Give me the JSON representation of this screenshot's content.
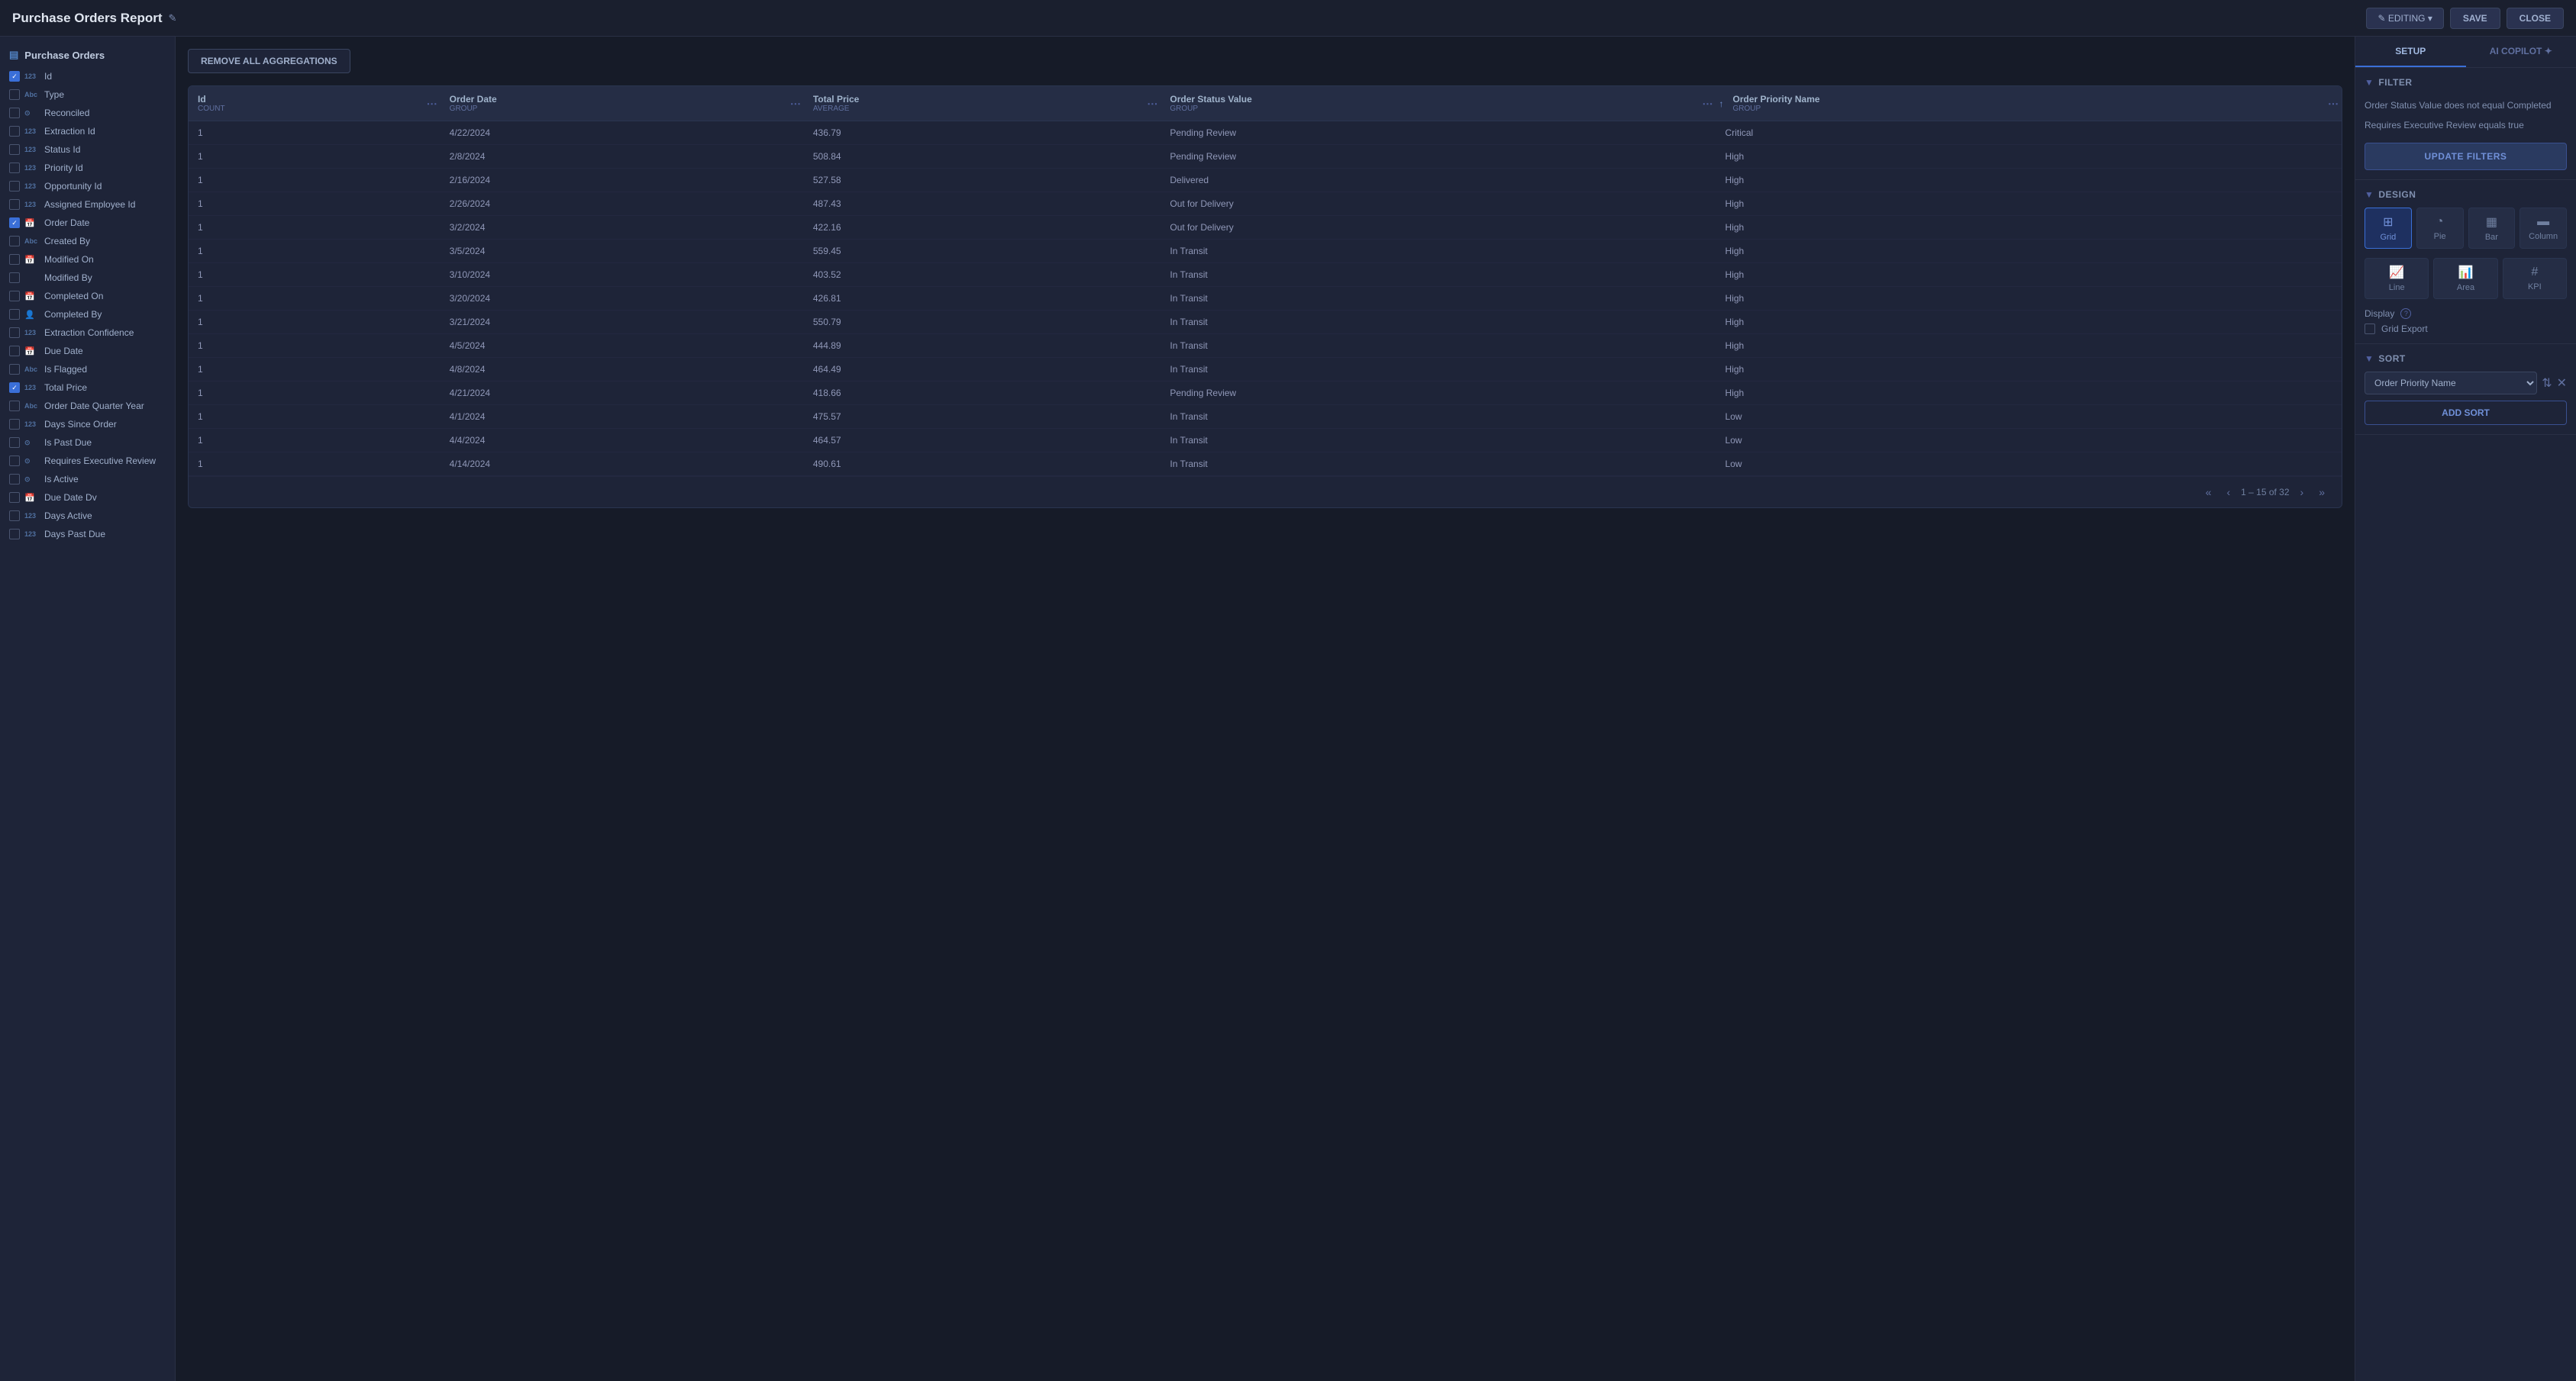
{
  "topbar": {
    "title": "Purchase Orders Report",
    "edit_icon": "✎",
    "editing_label": "✎ EDITING ▾",
    "save_label": "SAVE",
    "close_label": "CLOSE"
  },
  "sidebar": {
    "header_label": "Purchase Orders",
    "header_icon": "▤",
    "fields": [
      {
        "id": "id",
        "name": "Id",
        "type": "123",
        "icon": null,
        "checked": true
      },
      {
        "id": "type",
        "name": "Type",
        "type": "Abc",
        "icon": null,
        "checked": false
      },
      {
        "id": "reconciled",
        "name": "Reconciled",
        "type": null,
        "icon": "toggle",
        "checked": false
      },
      {
        "id": "extraction_id",
        "name": "Extraction Id",
        "type": "123",
        "icon": null,
        "checked": false
      },
      {
        "id": "status_id",
        "name": "Status Id",
        "type": "123",
        "icon": null,
        "checked": false
      },
      {
        "id": "priority_id",
        "name": "Priority Id",
        "type": "123",
        "icon": null,
        "checked": false
      },
      {
        "id": "opportunity_id",
        "name": "Opportunity Id",
        "type": "123",
        "icon": null,
        "checked": false
      },
      {
        "id": "assigned_employee_id",
        "name": "Assigned Employee Id",
        "type": "123",
        "icon": null,
        "checked": false
      },
      {
        "id": "order_date",
        "name": "Order Date",
        "type": null,
        "icon": "calendar",
        "checked": true
      },
      {
        "id": "created_by",
        "name": "Created By",
        "type": "Abc",
        "icon": null,
        "checked": false
      },
      {
        "id": "modified_on",
        "name": "Modified On",
        "type": null,
        "icon": "calendar",
        "checked": false
      },
      {
        "id": "modified_by",
        "name": "Modified By",
        "type": null,
        "icon": null,
        "checked": false
      },
      {
        "id": "completed_on",
        "name": "Completed On",
        "type": null,
        "icon": "calendar",
        "checked": false
      },
      {
        "id": "completed_by",
        "name": "Completed By",
        "type": null,
        "icon": "person",
        "checked": false
      },
      {
        "id": "extraction_confidence",
        "name": "Extraction Confidence",
        "type": "123",
        "icon": null,
        "checked": false
      },
      {
        "id": "due_date",
        "name": "Due Date",
        "type": null,
        "icon": "calendar",
        "checked": false
      },
      {
        "id": "is_flagged",
        "name": "Is Flagged",
        "type": "Abc",
        "icon": null,
        "checked": false
      },
      {
        "id": "total_price",
        "name": "Total Price",
        "type": "123",
        "icon": null,
        "checked": true
      },
      {
        "id": "order_date_quarter_year",
        "name": "Order Date Quarter Year",
        "type": "Abc",
        "icon": null,
        "checked": false
      },
      {
        "id": "days_since_order",
        "name": "Days Since Order",
        "type": "123",
        "icon": null,
        "checked": false
      },
      {
        "id": "is_past_due",
        "name": "Is Past Due",
        "type": null,
        "icon": "toggle",
        "checked": false
      },
      {
        "id": "requires_exec_review",
        "name": "Requires Executive Review",
        "type": null,
        "icon": "toggle",
        "checked": false
      },
      {
        "id": "is_active",
        "name": "Is Active",
        "type": null,
        "icon": "toggle",
        "checked": false
      },
      {
        "id": "due_date_dv",
        "name": "Due Date Dv",
        "type": null,
        "icon": "calendar",
        "checked": false
      },
      {
        "id": "days_active",
        "name": "Days Active",
        "type": "123",
        "icon": null,
        "checked": false
      },
      {
        "id": "days_past_due",
        "name": "Days Past Due",
        "type": "123",
        "icon": null,
        "checked": false
      }
    ]
  },
  "toolbar": {
    "remove_agg_label": "REMOVE ALL AGGREGATIONS"
  },
  "table": {
    "columns": [
      {
        "name": "Id",
        "agg": "COUNT"
      },
      {
        "name": "Order Date",
        "agg": "GROUP"
      },
      {
        "name": "Total Price",
        "agg": "AVERAGE"
      },
      {
        "name": "Order Status Value",
        "agg": "GROUP"
      },
      {
        "name": "Order Priority Name",
        "agg": "GROUP"
      }
    ],
    "rows": [
      [
        "1",
        "4/22/2024",
        "436.79",
        "Pending Review",
        "Critical"
      ],
      [
        "1",
        "2/8/2024",
        "508.84",
        "Pending Review",
        "High"
      ],
      [
        "1",
        "2/16/2024",
        "527.58",
        "Delivered",
        "High"
      ],
      [
        "1",
        "2/26/2024",
        "487.43",
        "Out for Delivery",
        "High"
      ],
      [
        "1",
        "3/2/2024",
        "422.16",
        "Out for Delivery",
        "High"
      ],
      [
        "1",
        "3/5/2024",
        "559.45",
        "In Transit",
        "High"
      ],
      [
        "1",
        "3/10/2024",
        "403.52",
        "In Transit",
        "High"
      ],
      [
        "1",
        "3/20/2024",
        "426.81",
        "In Transit",
        "High"
      ],
      [
        "1",
        "3/21/2024",
        "550.79",
        "In Transit",
        "High"
      ],
      [
        "1",
        "4/5/2024",
        "444.89",
        "In Transit",
        "High"
      ],
      [
        "1",
        "4/8/2024",
        "464.49",
        "In Transit",
        "High"
      ],
      [
        "1",
        "4/21/2024",
        "418.66",
        "Pending Review",
        "High"
      ],
      [
        "1",
        "4/1/2024",
        "475.57",
        "In Transit",
        "Low"
      ],
      [
        "1",
        "4/4/2024",
        "464.57",
        "In Transit",
        "Low"
      ],
      [
        "1",
        "4/14/2024",
        "490.61",
        "In Transit",
        "Low"
      ]
    ],
    "pagination": {
      "current_range": "1 – 15",
      "total": "32",
      "display": "1 – 15 of 32"
    }
  },
  "right_panel": {
    "tabs": [
      {
        "id": "setup",
        "label": "SETUP"
      },
      {
        "id": "ai_copilot",
        "label": "AI COPILOT ✦"
      }
    ],
    "active_tab": "setup",
    "filter": {
      "section_label": "FILTER",
      "conditions": [
        "Order Status Value does not equal Completed",
        "Requires Executive Review equals true"
      ],
      "update_btn_label": "UPDATE FILTERS"
    },
    "design": {
      "section_label": "DESIGN",
      "options_row1": [
        {
          "id": "grid",
          "label": "Grid",
          "icon": "⊞",
          "active": true
        },
        {
          "id": "pie",
          "label": "Pie",
          "icon": "◔"
        },
        {
          "id": "bar",
          "label": "Bar",
          "icon": "▦"
        },
        {
          "id": "column",
          "label": "Column",
          "icon": "▬"
        }
      ],
      "options_row2": [
        {
          "id": "line",
          "label": "Line",
          "icon": "📈"
        },
        {
          "id": "area",
          "label": "Area",
          "icon": "📊"
        },
        {
          "id": "kpi",
          "label": "KPI",
          "icon": "#"
        }
      ],
      "display_label": "Display",
      "grid_export_label": "Grid Export"
    },
    "sort": {
      "section_label": "SORT",
      "sort_field": "Order Priority Name",
      "add_sort_label": "ADD SORT"
    }
  }
}
